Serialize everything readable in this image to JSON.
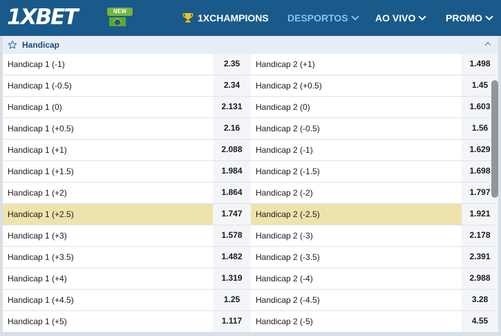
{
  "header": {
    "logo_text": "1XBET",
    "new_badge": "NEW",
    "nav": [
      {
        "label": "1XCHAMPIONS",
        "active": false
      },
      {
        "label": "DESPORTOS",
        "active": true
      },
      {
        "label": "AO VIVO",
        "active": false
      },
      {
        "label": "PROMO",
        "active": false
      }
    ]
  },
  "market": {
    "title": "Handicap",
    "rows": [
      {
        "h1": "Handicap 1 (-1)",
        "o1": "2.35",
        "h2": "Handicap 2 (+1)",
        "o2": "1.498"
      },
      {
        "h1": "Handicap 1 (-0.5)",
        "o1": "2.34",
        "h2": "Handicap 2 (+0.5)",
        "o2": "1.45"
      },
      {
        "h1": "Handicap 1 (0)",
        "o1": "2.131",
        "h2": "Handicap 2 (0)",
        "o2": "1.603"
      },
      {
        "h1": "Handicap 1 (+0.5)",
        "o1": "2.16",
        "h2": "Handicap 2 (-0.5)",
        "o2": "1.56"
      },
      {
        "h1": "Handicap 1 (+1)",
        "o1": "2.088",
        "h2": "Handicap 2 (-1)",
        "o2": "1.629"
      },
      {
        "h1": "Handicap 1 (+1.5)",
        "o1": "1.984",
        "h2": "Handicap 2 (-1.5)",
        "o2": "1.698"
      },
      {
        "h1": "Handicap 1 (+2)",
        "o1": "1.864",
        "h2": "Handicap 2 (-2)",
        "o2": "1.797"
      },
      {
        "h1": "Handicap 1 (+2.5)",
        "o1": "1.747",
        "h2": "Handicap 2 (-2.5)",
        "o2": "1.921"
      },
      {
        "h1": "Handicap 1 (+3)",
        "o1": "1.578",
        "h2": "Handicap 2 (-3)",
        "o2": "2.178"
      },
      {
        "h1": "Handicap 1 (+3.5)",
        "o1": "1.482",
        "h2": "Handicap 2 (-3.5)",
        "o2": "2.391"
      },
      {
        "h1": "Handicap 1 (+4)",
        "o1": "1.319",
        "h2": "Handicap 2 (-4)",
        "o2": "2.988"
      },
      {
        "h1": "Handicap 1 (+4.5)",
        "o1": "1.25",
        "h2": "Handicap 2 (-4.5)",
        "o2": "3.28"
      },
      {
        "h1": "Handicap 1 (+5)",
        "o1": "1.117",
        "h2": "Handicap 2 (-5)",
        "o2": "4.55"
      }
    ]
  },
  "colors": {
    "header_bg": "#195a8a",
    "active_nav": "#7dc5ff",
    "highlight_row": "#efe3ad",
    "section_bg": "#e7eef6"
  }
}
